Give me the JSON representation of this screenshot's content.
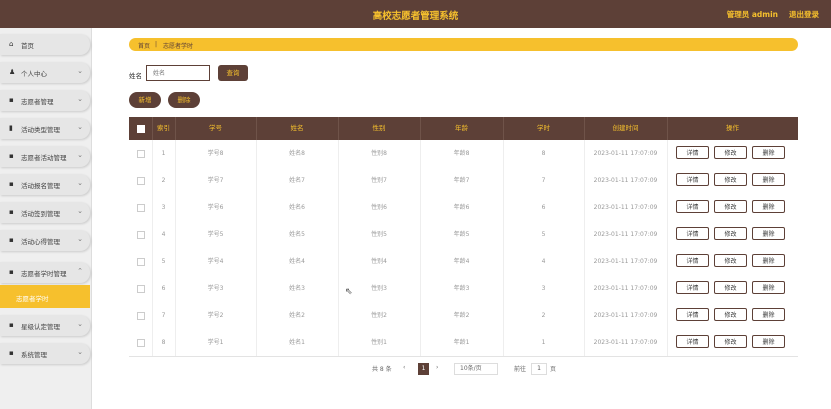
{
  "header": {
    "title": "高校志愿者管理系统",
    "admin_label": "管理员 admin",
    "logout_label": "退出登录"
  },
  "sidebar": {
    "items": [
      {
        "label": "首页",
        "icon": "home-icon"
      },
      {
        "label": "个人中心",
        "icon": "user-icon"
      },
      {
        "label": "志愿者管理",
        "icon": "grid-icon"
      },
      {
        "label": "活动类型管理",
        "icon": "chart-icon"
      },
      {
        "label": "志愿者活动管理",
        "icon": "grid-icon"
      },
      {
        "label": "活动报名管理",
        "icon": "grid-icon"
      },
      {
        "label": "活动签到管理",
        "icon": "grid-icon"
      },
      {
        "label": "活动心得管理",
        "icon": "grid-icon"
      },
      {
        "label": "志愿者学时管理",
        "icon": "grid-icon"
      },
      {
        "label": "星级认定管理",
        "icon": "grid-icon"
      },
      {
        "label": "系统管理",
        "icon": "grid-icon"
      }
    ],
    "active_sub": "志愿者学时"
  },
  "breadcrumb": {
    "home": "首页",
    "separator": "|",
    "current": "志愿者学时"
  },
  "search": {
    "label": "姓名",
    "placeholder": "姓名",
    "query_button": "查询"
  },
  "actions": {
    "add": "新增",
    "delete": "删除"
  },
  "table": {
    "headers": [
      "",
      "索引",
      "学号",
      "姓名",
      "性别",
      "年龄",
      "学时",
      "创建时间",
      "操作"
    ],
    "rows": [
      {
        "index": "1",
        "student_no": "学号8",
        "name": "姓名8",
        "gender": "性别8",
        "age": "年龄8",
        "hours": "8",
        "created": "2023-01-11 17:07:09"
      },
      {
        "index": "2",
        "student_no": "学号7",
        "name": "姓名7",
        "gender": "性别7",
        "age": "年龄7",
        "hours": "7",
        "created": "2023-01-11 17:07:09"
      },
      {
        "index": "3",
        "student_no": "学号6",
        "name": "姓名6",
        "gender": "性别6",
        "age": "年龄6",
        "hours": "6",
        "created": "2023-01-11 17:07:09"
      },
      {
        "index": "4",
        "student_no": "学号5",
        "name": "姓名5",
        "gender": "性别5",
        "age": "年龄5",
        "hours": "5",
        "created": "2023-01-11 17:07:09"
      },
      {
        "index": "5",
        "student_no": "学号4",
        "name": "姓名4",
        "gender": "性别4",
        "age": "年龄4",
        "hours": "4",
        "created": "2023-01-11 17:07:09"
      },
      {
        "index": "6",
        "student_no": "学号3",
        "name": "姓名3",
        "gender": "性别3",
        "age": "年龄3",
        "hours": "3",
        "created": "2023-01-11 17:07:09"
      },
      {
        "index": "7",
        "student_no": "学号2",
        "name": "姓名2",
        "gender": "性别2",
        "age": "年龄2",
        "hours": "2",
        "created": "2023-01-11 17:07:09"
      },
      {
        "index": "8",
        "student_no": "学号1",
        "name": "姓名1",
        "gender": "性别1",
        "age": "年龄1",
        "hours": "1",
        "created": "2023-01-11 17:07:09"
      }
    ],
    "row_actions": {
      "detail": "详情",
      "edit": "修改",
      "delete": "删除"
    }
  },
  "pagination": {
    "total": "共 8 条",
    "prev": "‹",
    "current_page": "1",
    "next": "›",
    "page_size": "10条/页",
    "goto_label": "前往",
    "goto_value": "1",
    "page_suffix": "页"
  },
  "colors": {
    "brand_dark": "#5d4037",
    "accent_yellow": "#f6c02d"
  }
}
